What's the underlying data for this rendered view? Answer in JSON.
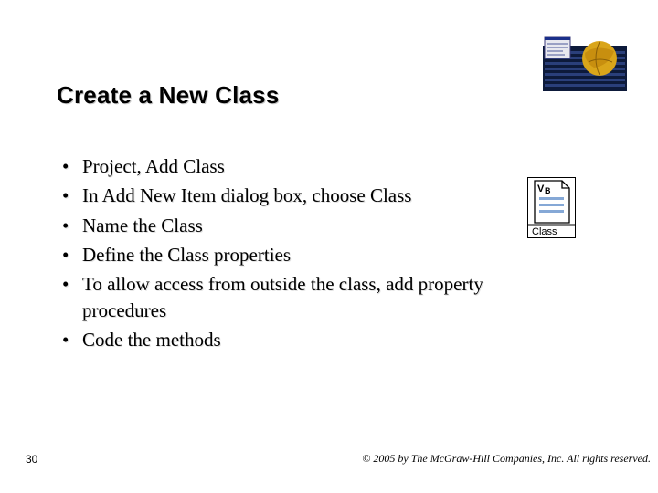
{
  "title": "Create a New Class",
  "bullets": [
    "Project, Add Class",
    "In Add New Item dialog box, choose Class",
    "Name the Class",
    "Define the Class properties",
    "To allow access from outside the class, add property procedures",
    "Code the methods"
  ],
  "class_icon_label": "Class",
  "class_icon_tag": "VB",
  "page_number": "30",
  "copyright": "© 2005 by The McGraw-Hill Companies, Inc. All rights reserved."
}
